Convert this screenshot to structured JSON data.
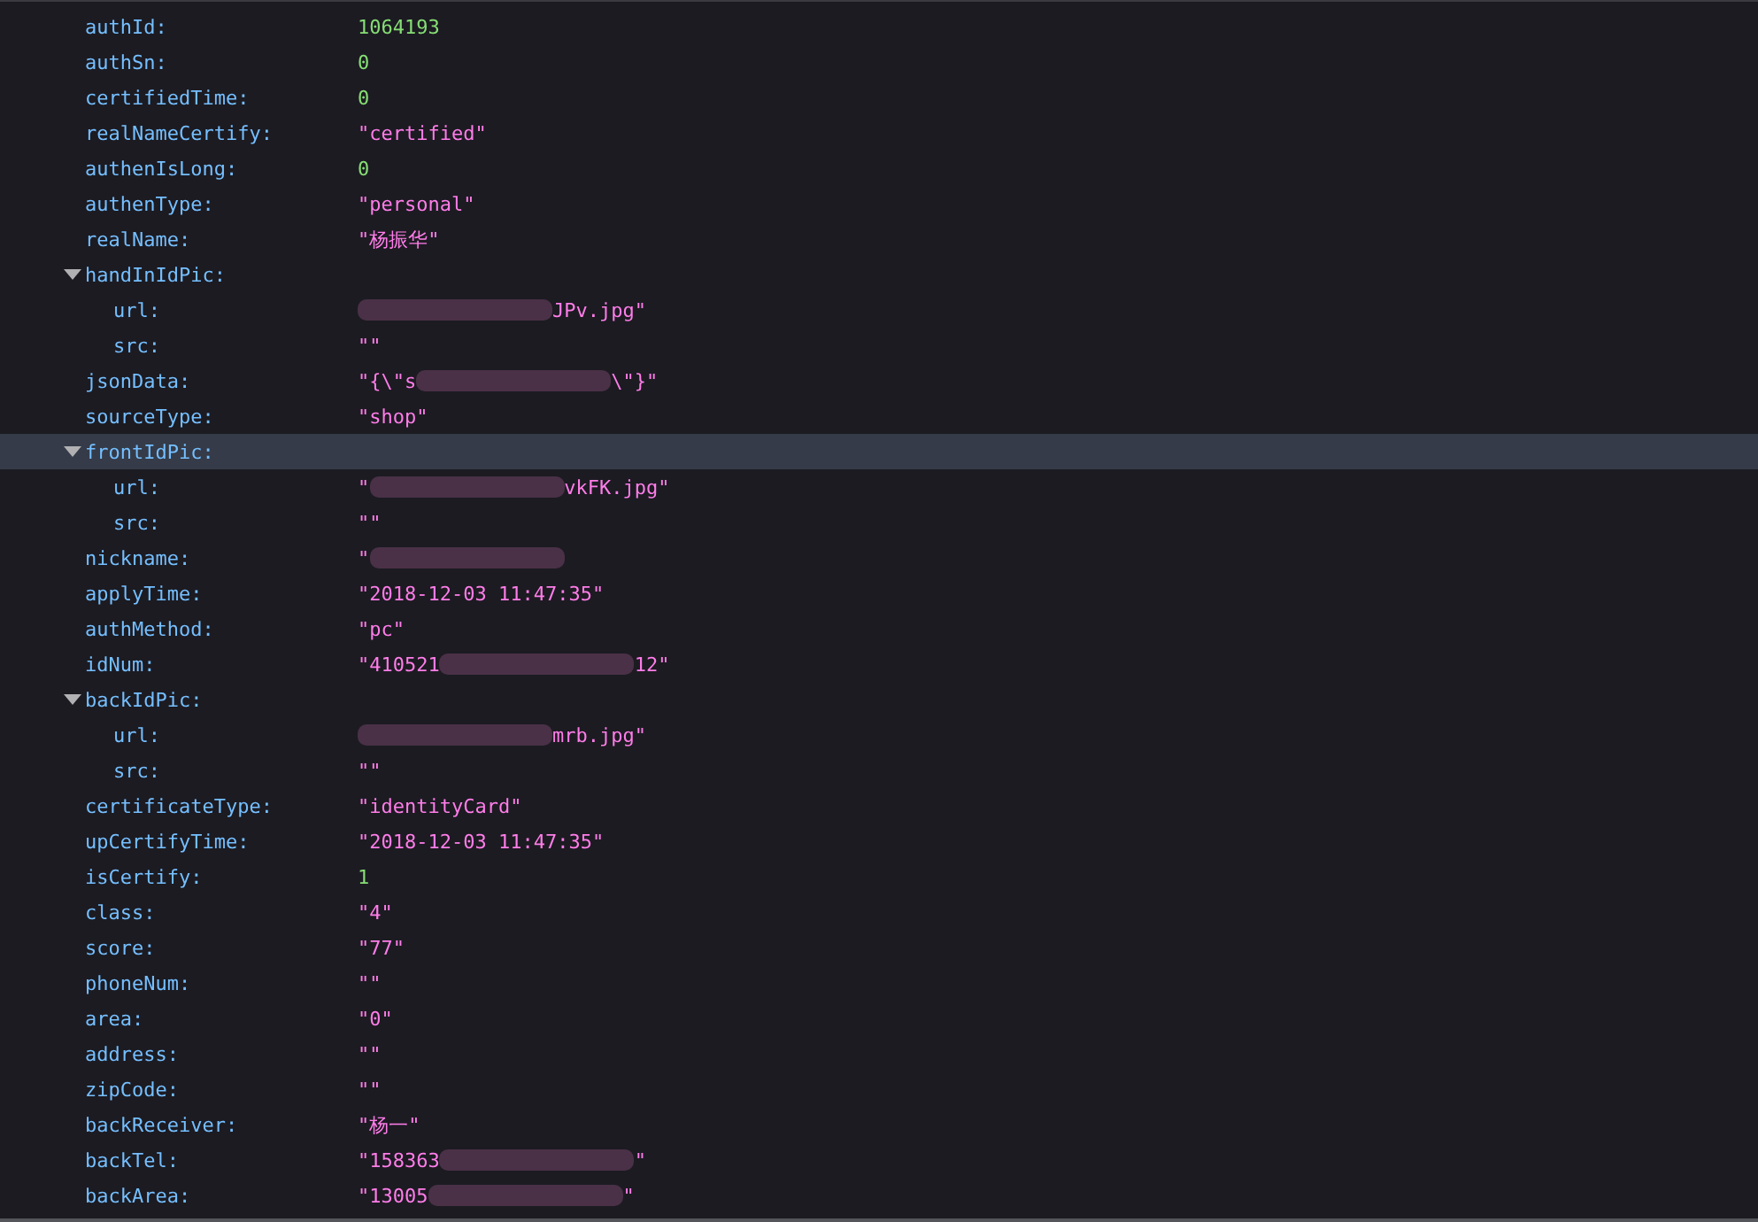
{
  "rows": [
    {
      "key": "authId:",
      "kind": "number",
      "value": "1064193",
      "selected": false
    },
    {
      "key": "authSn:",
      "kind": "number",
      "value": "0",
      "selected": false
    },
    {
      "key": "certifiedTime:",
      "kind": "number",
      "value": "0",
      "selected": false
    },
    {
      "key": "realNameCertify:",
      "kind": "string",
      "value": "\"certified\"",
      "selected": false
    },
    {
      "key": "authenIsLong:",
      "kind": "number",
      "value": "0",
      "selected": false
    },
    {
      "key": "authenType:",
      "kind": "string",
      "value": "\"personal\"",
      "selected": false
    },
    {
      "key": "realName:",
      "kind": "string",
      "value": "\"杨振华\"",
      "selected": false
    },
    {
      "key": "handInIdPic:",
      "kind": "object",
      "expanded": true,
      "selected": false,
      "children": [
        {
          "key": "url:",
          "kind": "string",
          "redacted": true,
          "value_after": "JPv.jpg\"",
          "selected": false
        },
        {
          "key": "src:",
          "kind": "string",
          "value": "\"\"",
          "selected": false
        }
      ]
    },
    {
      "key": "jsonData:",
      "kind": "string",
      "redacted": true,
      "value": "\"{\\\"s",
      "value_after": "\\\"}\"",
      "selected": false
    },
    {
      "key": "sourceType:",
      "kind": "string",
      "value": "\"shop\"",
      "selected": false
    },
    {
      "key": "frontIdPic:",
      "kind": "object",
      "expanded": true,
      "selected": true,
      "children": [
        {
          "key": "url:",
          "kind": "string",
          "redacted": true,
          "value": "\"",
          "value_after": "vkFK.jpg\"",
          "selected": false
        },
        {
          "key": "src:",
          "kind": "string",
          "value": "\"\"",
          "selected": false
        }
      ]
    },
    {
      "key": "nickname:",
      "kind": "string",
      "redacted": true,
      "value": "\"",
      "selected": false
    },
    {
      "key": "applyTime:",
      "kind": "string",
      "value": "\"2018-12-03 11:47:35\"",
      "selected": false
    },
    {
      "key": "authMethod:",
      "kind": "string",
      "value": "\"pc\"",
      "selected": false
    },
    {
      "key": "idNum:",
      "kind": "string",
      "redacted": true,
      "value": "\"410521",
      "value_after": "12\"",
      "selected": false
    },
    {
      "key": "backIdPic:",
      "kind": "object",
      "expanded": true,
      "selected": false,
      "children": [
        {
          "key": "url:",
          "kind": "string",
          "redacted": true,
          "value_after": "mrb.jpg\"",
          "selected": false
        },
        {
          "key": "src:",
          "kind": "string",
          "value": "\"\"",
          "selected": false
        }
      ]
    },
    {
      "key": "certificateType:",
      "kind": "string",
      "value": "\"identityCard\"",
      "selected": false
    },
    {
      "key": "upCertifyTime:",
      "kind": "string",
      "value": "\"2018-12-03 11:47:35\"",
      "selected": false
    },
    {
      "key": "isCertify:",
      "kind": "number",
      "value": "1",
      "selected": false
    },
    {
      "key": "class:",
      "kind": "string",
      "value": "\"4\"",
      "selected": false
    },
    {
      "key": "score:",
      "kind": "string",
      "value": "\"77\"",
      "selected": false
    },
    {
      "key": "phoneNum:",
      "kind": "string",
      "value": "\"\"",
      "selected": false
    },
    {
      "key": "area:",
      "kind": "string",
      "value": "\"0\"",
      "selected": false
    },
    {
      "key": "address:",
      "kind": "string",
      "value": "\"\"",
      "selected": false
    },
    {
      "key": "zipCode:",
      "kind": "string",
      "value": "\"\"",
      "selected": false
    },
    {
      "key": "backReceiver:",
      "kind": "string",
      "value": "\"杨一\"",
      "selected": false
    },
    {
      "key": "backTel:",
      "kind": "string",
      "redacted": true,
      "value": "\"158363",
      "value_after": "\"",
      "selected": false
    },
    {
      "key": "backArea:",
      "kind": "string",
      "redacted": true,
      "value": "\"13005",
      "value_after": "\"",
      "selected": false
    }
  ]
}
